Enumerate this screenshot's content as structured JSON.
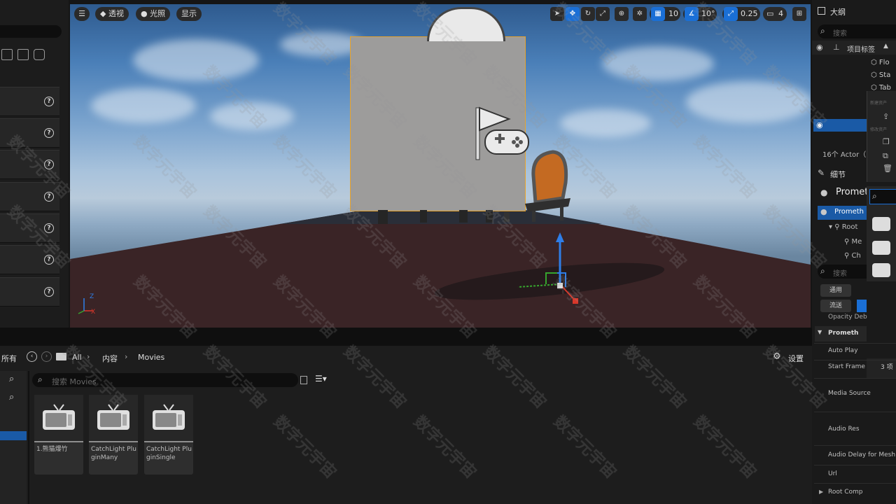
{
  "viewport": {
    "toolbar": {
      "perspective_label": "透视",
      "lighting_label": "光照",
      "show_label": "显示",
      "grid_value": "10",
      "rotation_value": "10°",
      "scale_value": "0.25",
      "camera_speed": "4"
    },
    "axis_labels": {
      "x": "X",
      "y": "Y",
      "z": "Z"
    }
  },
  "content_browser": {
    "breadcrumb": [
      "所有",
      "All",
      "内容",
      "Movies"
    ],
    "settings_label": "设置",
    "search_placeholder": "搜索 Movies",
    "assets": [
      {
        "label": "1.熊猫爆竹"
      },
      {
        "label": "CatchLight PluginMany"
      },
      {
        "label": "CatchLight PluginSingle"
      }
    ]
  },
  "outliner": {
    "title": "大纲",
    "search_placeholder": "搜索",
    "column_label": "项目标签",
    "items": [
      "Flo",
      "Sta",
      "Tab"
    ],
    "actor_count": "16个 Actor（",
    "menu_section_1": "新建资产",
    "menu_section_2": "修改资产",
    "menu_section_3": "3 项"
  },
  "details": {
    "title": "细节",
    "object_name": "Promet",
    "component_root": "Prometh",
    "tree": [
      "Root",
      "Me",
      "Ch"
    ],
    "search_placeholder": "搜索",
    "filter_general": "通用",
    "filter_stream": "流送",
    "truncated_prop": "Opacity Deb",
    "section_title": "Prometh",
    "properties": [
      "Auto Play",
      "Start Frame",
      "Media Source",
      "Audio Res",
      "Audio Delay for Mesh",
      "Url",
      "Root Comp"
    ]
  },
  "watermark_text": "数字元宇宙"
}
